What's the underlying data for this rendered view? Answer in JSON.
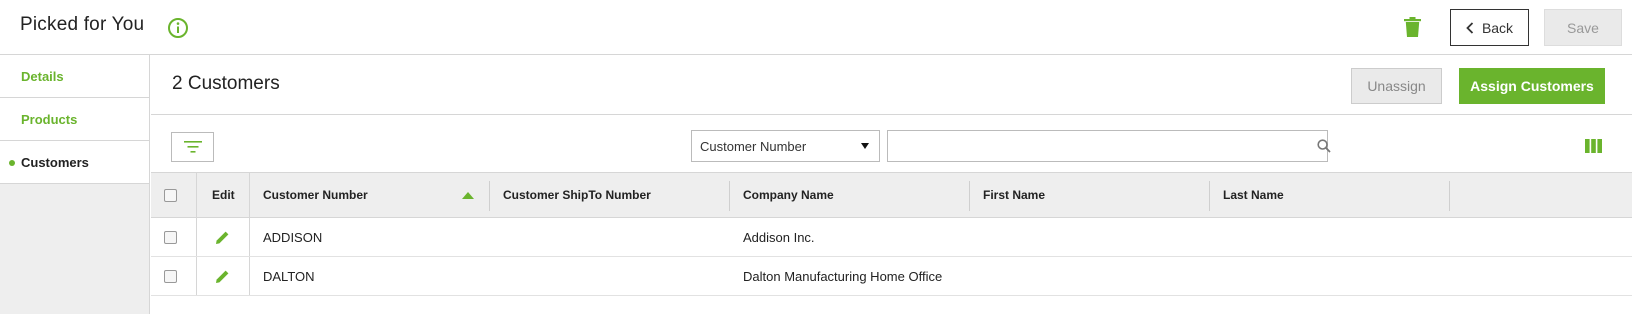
{
  "header": {
    "title": "Picked for You",
    "back_label": "Back",
    "save_label": "Save"
  },
  "sidebar": {
    "items": [
      {
        "label": "Details",
        "active": false
      },
      {
        "label": "Products",
        "active": false
      },
      {
        "label": "Customers",
        "active": true
      }
    ]
  },
  "section": {
    "title": "2 Customers",
    "unassign_label": "Unassign",
    "assign_label": "Assign Customers"
  },
  "search": {
    "field_select": "Customer Number",
    "query": "",
    "placeholder": ""
  },
  "table": {
    "edit_header": "Edit",
    "columns": [
      "Customer Number",
      "Customer ShipTo Number",
      "Company Name",
      "First Name",
      "Last Name"
    ],
    "sort_column": "Customer Number",
    "sort_direction": "ascending",
    "rows": [
      {
        "customer_number": "ADDISON",
        "shipto_number": "",
        "company_name": "Addison Inc.",
        "first_name": "",
        "last_name": ""
      },
      {
        "customer_number": "DALTON",
        "shipto_number": "",
        "company_name": "Dalton Manufacturing Home Office",
        "first_name": "",
        "last_name": ""
      }
    ]
  },
  "colors": {
    "accent": "#6ab42d",
    "text": "#222222",
    "border": "#d6d6d6",
    "panel": "#eeeeee"
  }
}
